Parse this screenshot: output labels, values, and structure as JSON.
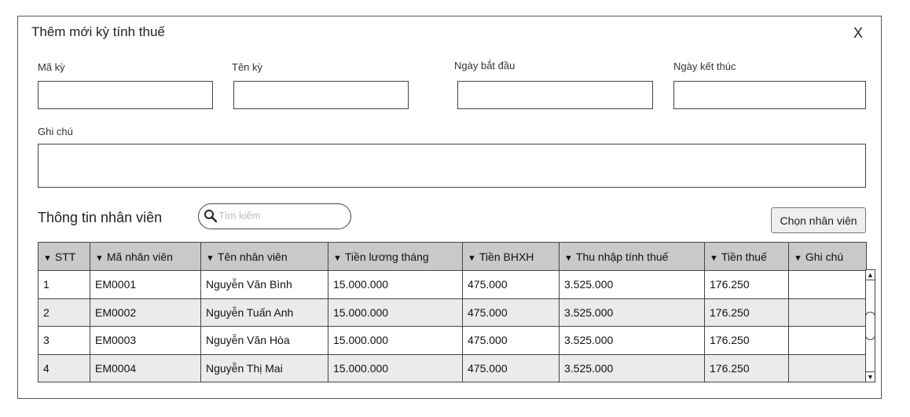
{
  "dialog": {
    "title": "Thêm mới kỳ tính thuế",
    "close_label": "X"
  },
  "form": {
    "code_label": "Mã kỳ",
    "name_label": "Tên kỳ",
    "start_label": "Ngày bắt đầu",
    "end_label": "Ngày kết thúc",
    "note_label": "Ghi chú",
    "code_value": "",
    "name_value": "",
    "start_value": "",
    "end_value": "",
    "note_value": ""
  },
  "employees": {
    "section_title": "Thông tin nhân viên",
    "search_placeholder": "Tìm kiếm",
    "choose_button": "Chọn nhân viên",
    "sort_icon": "▼",
    "columns": [
      "STT",
      "Mã nhân viên",
      "Tên nhân viên",
      "Tiền lương tháng",
      "Tiền BHXH",
      "Thu nhập tính thuế",
      "Tiền thuế",
      "Ghi chú"
    ],
    "rows": [
      [
        "1",
        "EM0001",
        "Nguyễn Văn Bình",
        "15.000.000",
        "475.000",
        "3.525.000",
        "176.250",
        ""
      ],
      [
        "2",
        "EM0002",
        "Nguyễn Tuấn Anh",
        "15.000.000",
        "475.000",
        "3.525.000",
        "176.250",
        ""
      ],
      [
        "3",
        "EM0003",
        "Nguyễn Văn Hòa",
        "15.000.000",
        "475.000",
        "3.525.000",
        "176.250",
        ""
      ],
      [
        "4",
        "EM0004",
        "Nguyễn Thị Mai",
        "15.000.000",
        "475.000",
        "3.525.000",
        "176.250",
        ""
      ]
    ]
  },
  "scrollbar": {
    "up_icon": "▲",
    "down_icon": "▼"
  }
}
